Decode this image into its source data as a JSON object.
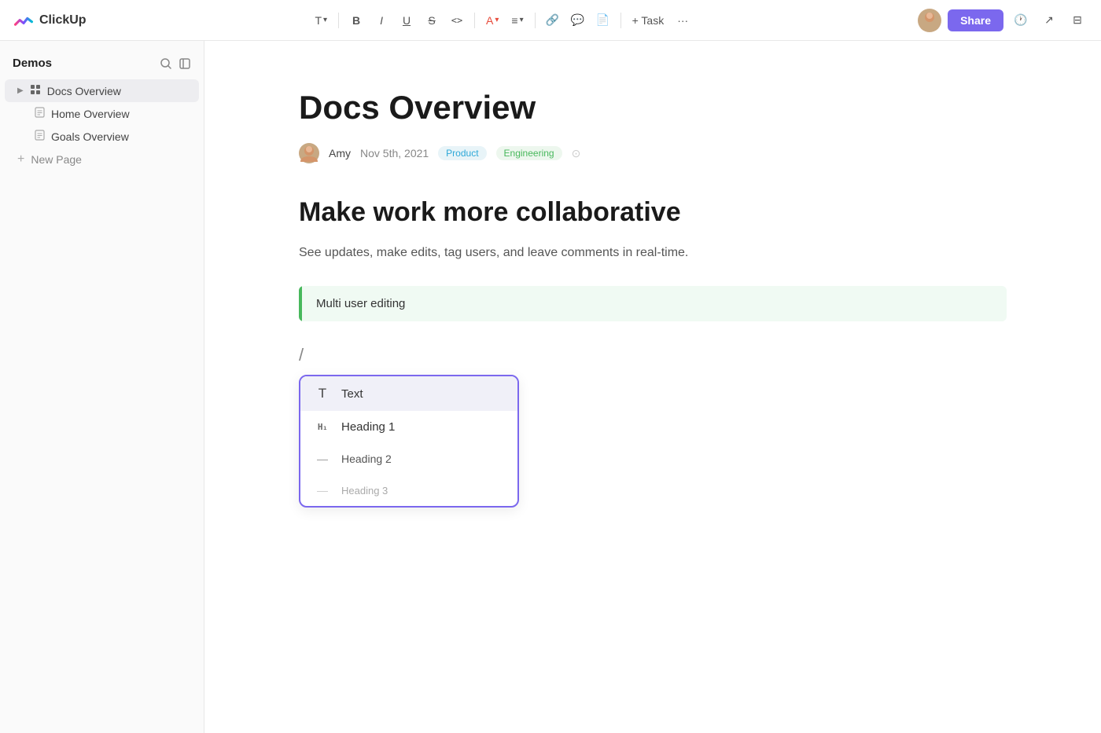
{
  "app": {
    "name": "ClickUp"
  },
  "toolbar": {
    "text_format_label": "T",
    "bold_label": "B",
    "italic_label": "I",
    "underline_label": "U",
    "strikethrough_label": "S",
    "code_label": "<>",
    "font_color_label": "A",
    "align_label": "≡",
    "link_label": "🔗",
    "comment_label": "💬",
    "doc_label": "📄",
    "task_label": "+ Task",
    "more_label": "···",
    "share_label": "Share"
  },
  "sidebar": {
    "title": "Demos",
    "items": [
      {
        "label": "Docs Overview",
        "icon": "grid",
        "active": true
      },
      {
        "label": "Home Overview",
        "icon": "doc"
      },
      {
        "label": "Goals Overview",
        "icon": "doc"
      }
    ],
    "new_page_label": "New Page"
  },
  "document": {
    "title": "Docs Overview",
    "author": "Amy",
    "date": "Nov 5th, 2021",
    "tags": [
      "Product",
      "Engineering"
    ],
    "heading": "Make work more collaborative",
    "subtitle": "See updates, make edits, tag users, and leave comments in real-time.",
    "blockquote": "Multi user editing",
    "slash": "/",
    "dropdown": {
      "items": [
        {
          "icon": "T",
          "label": "Text"
        },
        {
          "icon": "H1",
          "label": "Heading 1"
        },
        {
          "icon": "—",
          "label": "Heading 2"
        },
        {
          "icon": "—",
          "label": "Heading 3"
        }
      ]
    }
  }
}
